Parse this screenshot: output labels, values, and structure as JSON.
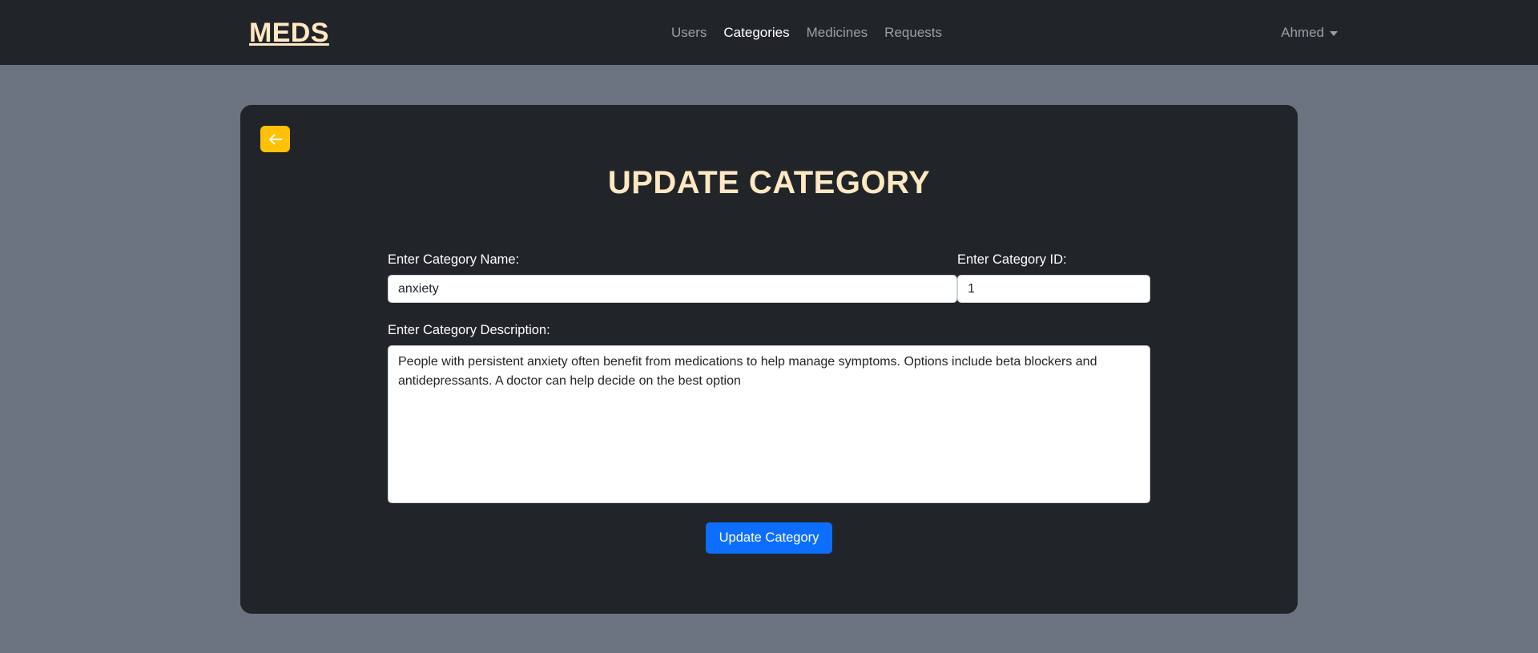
{
  "navbar": {
    "brand": "MEDS",
    "links": [
      {
        "label": "Users",
        "active": false
      },
      {
        "label": "Categories",
        "active": true
      },
      {
        "label": "Medicines",
        "active": false
      },
      {
        "label": "Requests",
        "active": false
      }
    ],
    "user": {
      "name": "Ahmed",
      "caret_icon": "chevron-down-icon"
    }
  },
  "card": {
    "back_button": {
      "icon": "arrow-left-icon",
      "color": "#ffc107"
    },
    "title": "Update Category",
    "form": {
      "name_field": {
        "label": "Enter Category Name:",
        "value": "anxiety",
        "placeholder": ""
      },
      "id_field": {
        "label": "Enter Category ID:",
        "value": "1",
        "placeholder": ""
      },
      "description_field": {
        "label": "Enter Category Description:",
        "value": "People with persistent anxiety often benefit from medications to help manage symptoms. Options include beta blockers and antidepressants. A doctor can help decide on the best option",
        "placeholder": ""
      },
      "submit_label": "Update Category"
    }
  },
  "colors": {
    "page_background": "#6b7280",
    "navbar_background": "#212529",
    "card_background": "#212529",
    "brand_text": "#ffe8c2",
    "title_text": "#ffe8c2",
    "accent_warning": "#ffc107",
    "accent_primary": "#0d6efd"
  }
}
